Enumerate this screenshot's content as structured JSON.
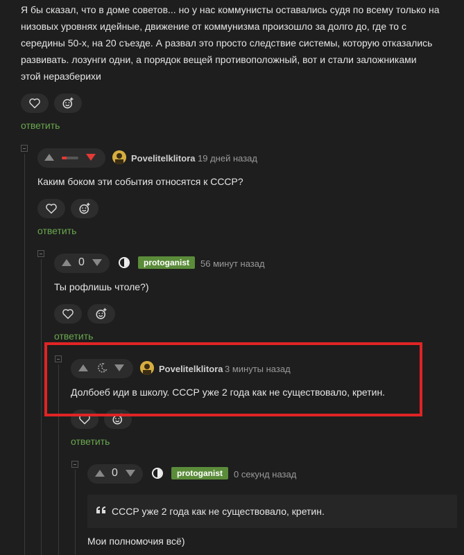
{
  "comments": {
    "top": {
      "text_lines": [
        "Я бы сказал, что в доме советов... но у нас коммунисты оставались судя по всему только на",
        "низовых уровнях идейные, движение от коммунизма произошло за долго до, где то с",
        "середины 50-х, на 20 съезде. А развал это просто следствие системы, которую отказались",
        "развивать. лозунги одни, а порядок вещей противоположный, вот и стали заложниками",
        "этой неразберихи"
      ],
      "reply_label": "ответить"
    },
    "c1": {
      "user": "Povelitelklitora",
      "time": "19 дней назад",
      "text": "Каким боком эти события относятся к СССР?",
      "reply_label": "ответить"
    },
    "c2": {
      "score": "0",
      "user": "protoganist",
      "time": "56 минут назад",
      "text": "Ты рофлишь чтоле?)",
      "reply_label": "ответить"
    },
    "c3": {
      "user": "Povelitelklitora",
      "time": "3 минуты назад",
      "text": "Долбоеб иди в школу. СССР уже 2 года как не существовало, кретин.",
      "reply_label": "ответить"
    },
    "c4": {
      "score": "0",
      "user": "protoganist",
      "time": "0 секунд назад",
      "quote": "СССР уже 2 года как не существовало, кретин.",
      "text": "Мои полномочия всё)"
    }
  },
  "colors": {
    "accent_green": "#6aa84f",
    "badge_green": "#5b8c3a",
    "downvote_red": "#e53935",
    "highlight_red": "#e02424"
  },
  "icons": [
    "heart-icon",
    "smiley-plus-icon",
    "upvote-icon",
    "downvote-icon",
    "collapse-icon",
    "half-circle-icon",
    "avatar-icon",
    "quote-icon",
    "moon-icon"
  ]
}
